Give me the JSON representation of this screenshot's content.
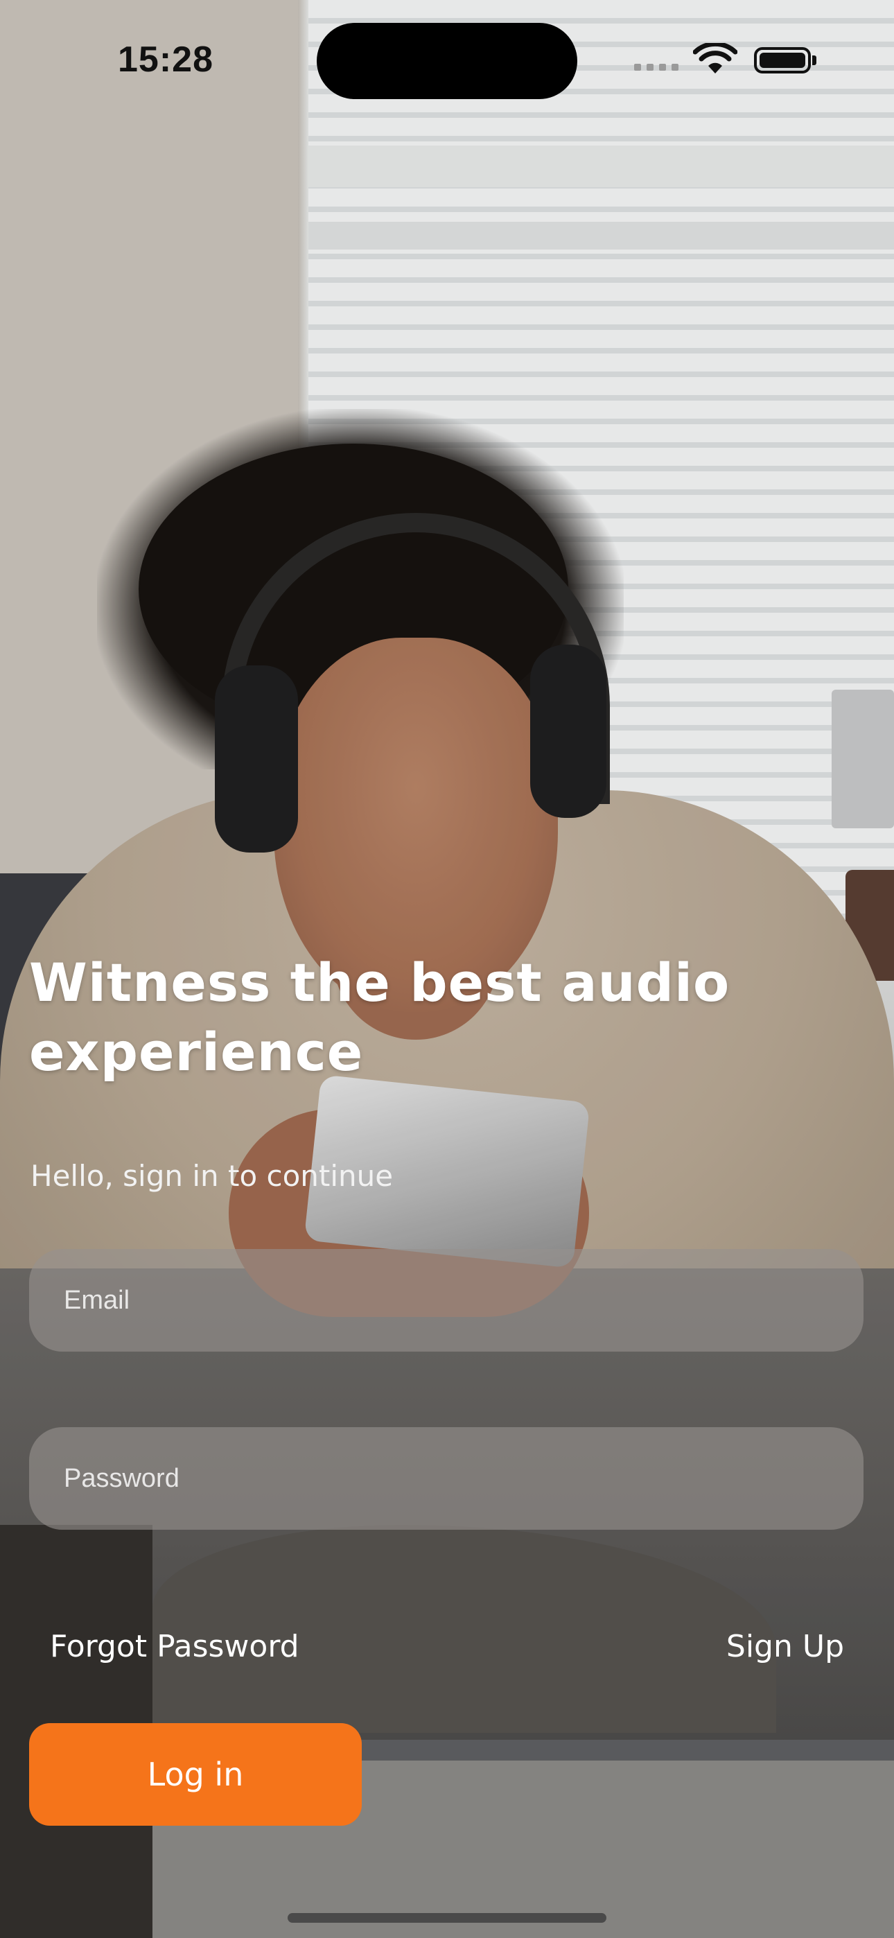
{
  "status_bar": {
    "time": "15:28"
  },
  "login": {
    "headline": "Witness the best audio experience",
    "subtitle": "Hello, sign in to continue",
    "email": {
      "value": "",
      "placeholder": "Email"
    },
    "password": {
      "value": "",
      "placeholder": "Password"
    },
    "forgot_password_label": "Forgot Password",
    "sign_up_label": "Sign Up",
    "login_button_label": "Log in",
    "accent_color": "#f5741a"
  },
  "background_photo": {
    "subject": "person-with-headphones-using-phone"
  }
}
